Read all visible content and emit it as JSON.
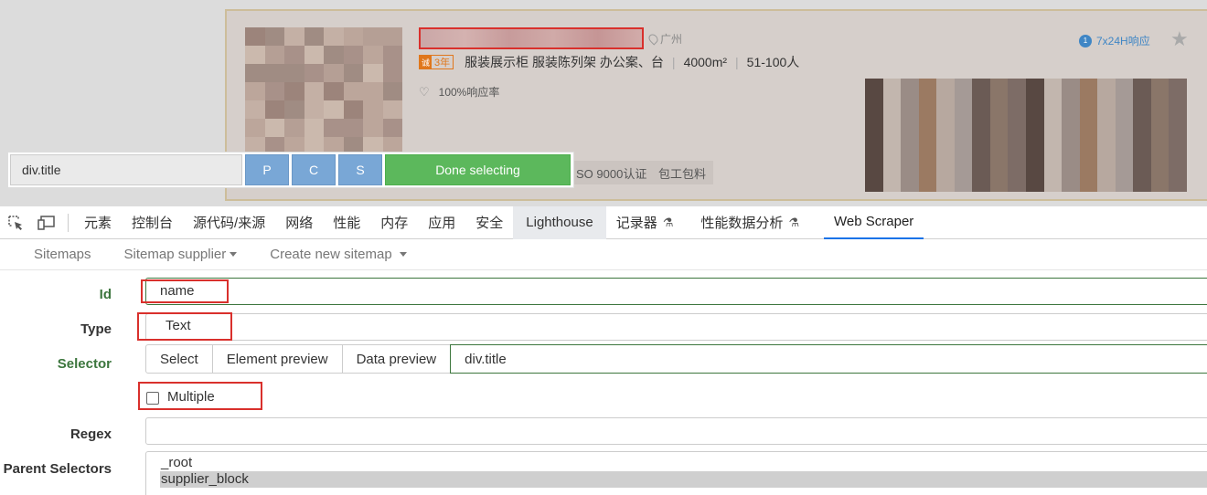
{
  "page": {
    "location": "广州",
    "year_badge_prefix": "诚",
    "year_badge": "3年",
    "products": "服装展示柜 服装陈列架 办公案、台",
    "area": "4000m²",
    "staff": "51-100人",
    "response_rate": "100%响应率",
    "response_time": "7x24H响应",
    "response_icon": "1",
    "tags": [
      "SO 9000认证",
      "包工包料"
    ]
  },
  "selector_bar": {
    "input_value": "div.title",
    "buttons": [
      "P",
      "C",
      "S"
    ],
    "done_label": "Done selecting"
  },
  "devtools": {
    "tabs": [
      "元素",
      "控制台",
      "源代码/来源",
      "网络",
      "性能",
      "内存",
      "应用",
      "安全",
      "Lighthouse",
      "记录器",
      "性能数据分析",
      "Web Scraper"
    ],
    "active_tab": "Web Scraper"
  },
  "ws_nav": {
    "sitemaps": "Sitemaps",
    "sitemap_supplier": "Sitemap supplier",
    "create_new": "Create new sitemap"
  },
  "form": {
    "id_label": "Id",
    "id_value": "name",
    "type_label": "Type",
    "type_value": "Text",
    "selector_label": "Selector",
    "select_btn": "Select",
    "element_preview_btn": "Element preview",
    "data_preview_btn": "Data preview",
    "selector_value": "div.title",
    "multiple_label": "Multiple",
    "multiple_checked": false,
    "regex_label": "Regex",
    "regex_value": "",
    "parent_label": "Parent Selectors",
    "parent_options": [
      "_root",
      "supplier_block"
    ],
    "parent_selected": "supplier_block"
  },
  "colors": {
    "highlight_red": "#d9302c",
    "done_green": "#5cb85c",
    "pcs_blue": "#79a7d6",
    "label_green": "#3c763d",
    "tab_active": "#1a73e8"
  }
}
